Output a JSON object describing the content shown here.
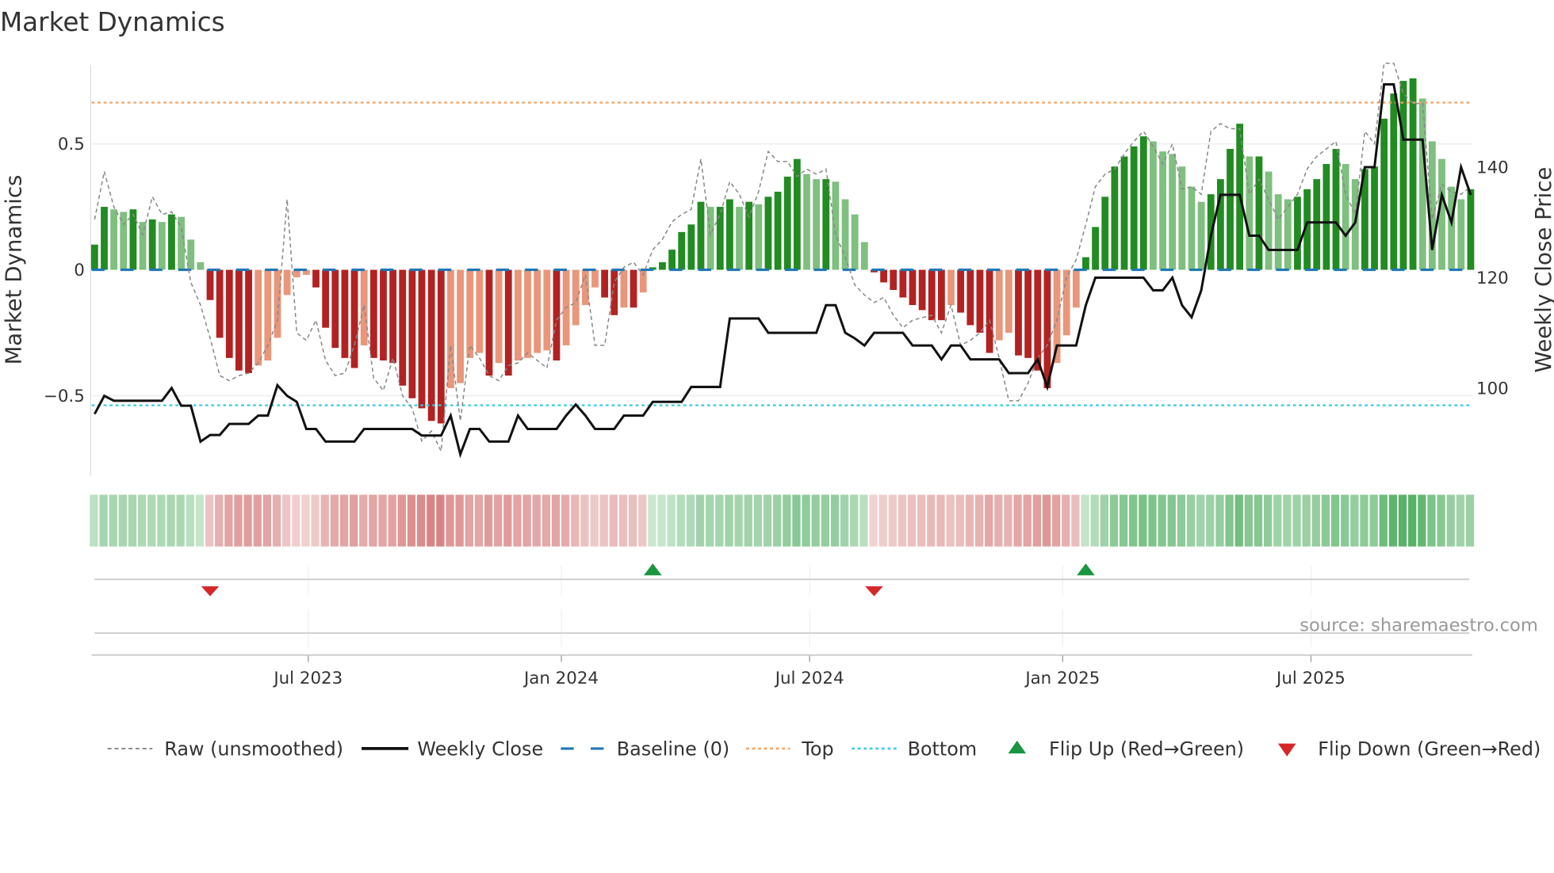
{
  "chart_data": {
    "type": "bar",
    "title": "Market Dynamics",
    "ylabel": "Market Dynamics",
    "y2label": "Weekly Close Price",
    "ylim": [
      -0.818,
      0.826
    ],
    "y2lim": [
      84.1,
      159.1
    ],
    "y_ticks": [
      {
        "value": 0.5,
        "label": "0.5"
      },
      {
        "value": 0,
        "label": "0"
      },
      {
        "value": -0.5,
        "label": "−0.5"
      }
    ],
    "y2_ticks": [
      {
        "value": 140,
        "label": "140"
      },
      {
        "value": 120,
        "label": "120"
      },
      {
        "value": 100,
        "label": "100"
      }
    ],
    "x_ticks": [
      {
        "index": 22.2,
        "label": "Jul 2023"
      },
      {
        "index": 48.5,
        "label": "Jan 2024"
      },
      {
        "index": 74.3,
        "label": "Jul 2024"
      },
      {
        "index": 100.6,
        "label": "Jan 2025"
      },
      {
        "index": 126.4,
        "label": "Jul 2025"
      }
    ],
    "top_level": 0.664,
    "bottom_level": -0.538,
    "baseline": 0,
    "dynamics": [
      0.1,
      0.25,
      0.24,
      0.23,
      0.24,
      0.19,
      0.2,
      0.19,
      0.22,
      0.21,
      0.12,
      0.03,
      -0.12,
      -0.27,
      -0.35,
      -0.4,
      -0.41,
      -0.38,
      -0.36,
      -0.27,
      -0.1,
      -0.03,
      -0.02,
      -0.07,
      -0.23,
      -0.31,
      -0.35,
      -0.39,
      -0.3,
      -0.35,
      -0.36,
      -0.37,
      -0.46,
      -0.51,
      -0.55,
      -0.6,
      -0.61,
      -0.47,
      -0.45,
      -0.35,
      -0.33,
      -0.42,
      -0.37,
      -0.42,
      -0.36,
      -0.35,
      -0.33,
      -0.32,
      -0.36,
      -0.3,
      -0.22,
      -0.14,
      -0.07,
      -0.11,
      -0.18,
      -0.15,
      -0.15,
      -0.09,
      0.01,
      0.03,
      0.08,
      0.15,
      0.18,
      0.27,
      0.25,
      0.25,
      0.28,
      0.25,
      0.27,
      0.26,
      0.29,
      0.31,
      0.37,
      0.44,
      0.38,
      0.36,
      0.36,
      0.35,
      0.28,
      0.22,
      0.11,
      -0.01,
      -0.05,
      -0.08,
      -0.11,
      -0.14,
      -0.16,
      -0.2,
      -0.2,
      -0.14,
      -0.17,
      -0.22,
      -0.25,
      -0.33,
      -0.28,
      -0.25,
      -0.34,
      -0.35,
      -0.4,
      -0.47,
      -0.37,
      -0.26,
      -0.15,
      0.05,
      0.17,
      0.29,
      0.41,
      0.45,
      0.49,
      0.53,
      0.51,
      0.47,
      0.46,
      0.41,
      0.33,
      0.27,
      0.3,
      0.36,
      0.48,
      0.58,
      0.45,
      0.45,
      0.39,
      0.3,
      0.28,
      0.29,
      0.32,
      0.36,
      0.42,
      0.48,
      0.42,
      0.36,
      0.4,
      0.41,
      0.6,
      0.7,
      0.75,
      0.76,
      0.68,
      0.51,
      0.44,
      0.33,
      0.28,
      0.32
    ],
    "raw": [
      0.2,
      0.39,
      0.25,
      0.18,
      0.22,
      0.14,
      0.29,
      0.22,
      0.23,
      0.17,
      -0.05,
      -0.14,
      -0.27,
      -0.42,
      -0.44,
      -0.42,
      -0.41,
      -0.37,
      -0.3,
      -0.2,
      0.28,
      -0.25,
      -0.28,
      -0.2,
      -0.36,
      -0.42,
      -0.41,
      -0.3,
      -0.14,
      -0.43,
      -0.48,
      -0.35,
      -0.5,
      -0.55,
      -0.68,
      -0.64,
      -0.72,
      -0.3,
      -0.6,
      -0.3,
      -0.35,
      -0.42,
      -0.44,
      -0.38,
      -0.37,
      -0.33,
      -0.36,
      -0.39,
      -0.2,
      -0.15,
      -0.13,
      -0.02,
      -0.3,
      -0.3,
      -0.05,
      0.01,
      0.03,
      -0.02,
      0.08,
      0.12,
      0.19,
      0.22,
      0.24,
      0.44,
      0.14,
      0.22,
      0.35,
      0.3,
      0.21,
      0.31,
      0.47,
      0.43,
      0.43,
      0.37,
      0.4,
      0.38,
      0.4,
      0.14,
      0.05,
      -0.06,
      -0.1,
      -0.13,
      -0.11,
      -0.18,
      -0.23,
      -0.2,
      -0.19,
      -0.18,
      -0.25,
      -0.14,
      -0.3,
      -0.28,
      -0.25,
      -0.2,
      -0.35,
      -0.52,
      -0.52,
      -0.45,
      -0.35,
      -0.3,
      -0.2,
      -0.03,
      0.04,
      0.18,
      0.33,
      0.38,
      0.4,
      0.46,
      0.51,
      0.55,
      0.49,
      0.42,
      0.5,
      0.32,
      0.33,
      0.3,
      0.55,
      0.58,
      0.56,
      0.56,
      0.3,
      0.36,
      0.28,
      0.2,
      0.25,
      0.3,
      0.4,
      0.45,
      0.48,
      0.51,
      0.3,
      0.22,
      0.55,
      0.5,
      0.82,
      0.82,
      0.7,
      0.66,
      0.66,
      0.2,
      0.34,
      0.31,
      0.3,
      0.33
    ],
    "weekly_close": [
      [
        0,
        95.3
      ],
      [
        1,
        98.6
      ],
      [
        2,
        97.7
      ],
      [
        7,
        97.7
      ],
      [
        8,
        100
      ],
      [
        9,
        96.8
      ],
      [
        10,
        96.8
      ],
      [
        11,
        90.3
      ],
      [
        12,
        91.5
      ],
      [
        13,
        91.5
      ],
      [
        14,
        93.5
      ],
      [
        16,
        93.5
      ],
      [
        17,
        95
      ],
      [
        18,
        95
      ],
      [
        19,
        100.5
      ],
      [
        20,
        98.6
      ],
      [
        21,
        97.5
      ],
      [
        22,
        92.6
      ],
      [
        23,
        92.6
      ],
      [
        24,
        90.3
      ],
      [
        27,
        90.3
      ],
      [
        28,
        92.6
      ],
      [
        33,
        92.6
      ],
      [
        34,
        91.4
      ],
      [
        36,
        91.4
      ],
      [
        37,
        95
      ],
      [
        38,
        88
      ],
      [
        39,
        92.6
      ],
      [
        40,
        92.6
      ],
      [
        41,
        90.3
      ],
      [
        43,
        90.3
      ],
      [
        44,
        95
      ],
      [
        45,
        92.6
      ],
      [
        48,
        92.6
      ],
      [
        49,
        95
      ],
      [
        50,
        97
      ],
      [
        51,
        95
      ],
      [
        52,
        92.6
      ],
      [
        54,
        92.6
      ],
      [
        55,
        95
      ],
      [
        57,
        95
      ],
      [
        58,
        97.5
      ],
      [
        61,
        97.5
      ],
      [
        62,
        100.2
      ],
      [
        65,
        100.2
      ],
      [
        66,
        112.6
      ],
      [
        69,
        112.6
      ],
      [
        70,
        110
      ],
      [
        75,
        110
      ],
      [
        76,
        115
      ],
      [
        77,
        115
      ],
      [
        78,
        110
      ],
      [
        79,
        109
      ],
      [
        80,
        107.7
      ],
      [
        81,
        110
      ],
      [
        84,
        110
      ],
      [
        85,
        107.7
      ],
      [
        87,
        107.7
      ],
      [
        88,
        105.2
      ],
      [
        89,
        107.7
      ],
      [
        90,
        107.7
      ],
      [
        91,
        105.2
      ],
      [
        94,
        105.2
      ],
      [
        95,
        102.7
      ],
      [
        97,
        102.7
      ],
      [
        98,
        105.2
      ],
      [
        99,
        100.2
      ],
      [
        100,
        107.7
      ],
      [
        102,
        107.7
      ],
      [
        103,
        115
      ],
      [
        104,
        120
      ],
      [
        109,
        120
      ],
      [
        110,
        117.7
      ],
      [
        111,
        117.7
      ],
      [
        112,
        120
      ],
      [
        113,
        115
      ],
      [
        114,
        112.8
      ],
      [
        115,
        117.7
      ],
      [
        116,
        127.6
      ],
      [
        117,
        135
      ],
      [
        119,
        135
      ],
      [
        120,
        127.6
      ],
      [
        121,
        127.6
      ],
      [
        122,
        125
      ],
      [
        125,
        125
      ],
      [
        126,
        130
      ],
      [
        129,
        130
      ],
      [
        130,
        127.6
      ],
      [
        131,
        130
      ],
      [
        132,
        140
      ],
      [
        133,
        140
      ],
      [
        134,
        155
      ],
      [
        135,
        155
      ],
      [
        136,
        145
      ],
      [
        138,
        145
      ],
      [
        139,
        125
      ],
      [
        140,
        135
      ],
      [
        141,
        130
      ],
      [
        142,
        140
      ],
      [
        143,
        135
      ]
    ],
    "flips": [
      {
        "index": 12,
        "direction": "down"
      },
      {
        "index": 58,
        "direction": "up"
      },
      {
        "index": 81,
        "direction": "down"
      },
      {
        "index": 103,
        "direction": "up"
      }
    ],
    "legend": [
      "Raw (unsmoothed)",
      "Weekly Close",
      "Baseline (0)",
      "Top",
      "Bottom",
      "Flip Up (Red→Green)",
      "Flip Down (Green→Red)"
    ],
    "legend_placement": "bottom",
    "source": "source: sharemaestro.com",
    "colors": {
      "green_strong": "#228b22",
      "green_weak": "#7fbf7f",
      "red_strong": "#b22222",
      "red_weak": "#e9967a",
      "top": "#f4a261",
      "bottom": "#3cc8dc",
      "baseline": "#1f77b4",
      "flip_up": "#1a9641",
      "flip_down": "#d62728"
    }
  }
}
